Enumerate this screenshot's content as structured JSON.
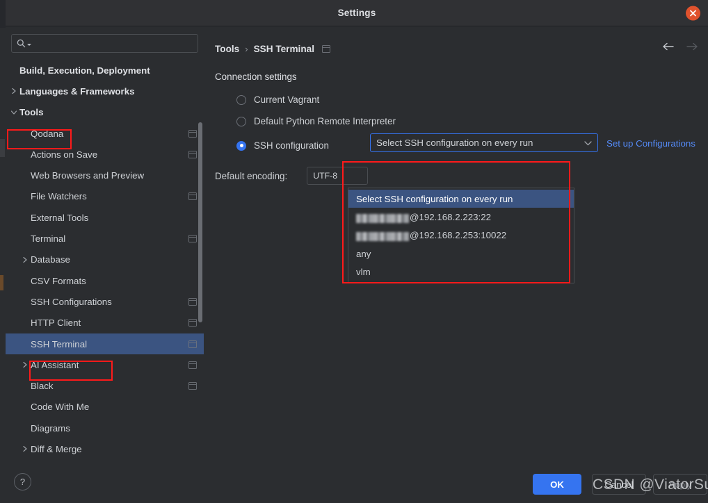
{
  "window": {
    "title": "Settings",
    "close_icon": "close-icon"
  },
  "search": {
    "value": "",
    "placeholder": "",
    "icon": "search-icon"
  },
  "sidebar": {
    "scrollbar": "vertical-scrollbar",
    "items": [
      {
        "label": "Build, Execution, Deployment",
        "level": 0,
        "arrow": "none",
        "badge": false,
        "selected": false,
        "bold": true
      },
      {
        "label": "Languages & Frameworks",
        "level": 0,
        "arrow": "collapsed",
        "badge": false,
        "selected": false,
        "bold": true
      },
      {
        "label": "Tools",
        "level": 0,
        "arrow": "expanded",
        "badge": false,
        "selected": false,
        "bold": true
      },
      {
        "label": "Qodana",
        "level": 1,
        "arrow": "none",
        "badge": true,
        "selected": false,
        "bold": false
      },
      {
        "label": "Actions on Save",
        "level": 1,
        "arrow": "none",
        "badge": true,
        "selected": false,
        "bold": false
      },
      {
        "label": "Web Browsers and Preview",
        "level": 1,
        "arrow": "none",
        "badge": false,
        "selected": false,
        "bold": false
      },
      {
        "label": "File Watchers",
        "level": 1,
        "arrow": "none",
        "badge": true,
        "selected": false,
        "bold": false
      },
      {
        "label": "External Tools",
        "level": 1,
        "arrow": "none",
        "badge": false,
        "selected": false,
        "bold": false
      },
      {
        "label": "Terminal",
        "level": 1,
        "arrow": "none",
        "badge": true,
        "selected": false,
        "bold": false
      },
      {
        "label": "Database",
        "level": 1,
        "arrow": "collapsed",
        "badge": false,
        "selected": false,
        "bold": false
      },
      {
        "label": "CSV Formats",
        "level": 1,
        "arrow": "none",
        "badge": false,
        "selected": false,
        "bold": false
      },
      {
        "label": "SSH Configurations",
        "level": 1,
        "arrow": "none",
        "badge": true,
        "selected": false,
        "bold": false
      },
      {
        "label": "HTTP Client",
        "level": 1,
        "arrow": "none",
        "badge": true,
        "selected": false,
        "bold": false
      },
      {
        "label": "SSH Terminal",
        "level": 1,
        "arrow": "none",
        "badge": true,
        "selected": true,
        "bold": false
      },
      {
        "label": "AI Assistant",
        "level": 1,
        "arrow": "collapsed",
        "badge": true,
        "selected": false,
        "bold": false
      },
      {
        "label": "Black",
        "level": 1,
        "arrow": "none",
        "badge": true,
        "selected": false,
        "bold": false
      },
      {
        "label": "Code With Me",
        "level": 1,
        "arrow": "none",
        "badge": false,
        "selected": false,
        "bold": false
      },
      {
        "label": "Diagrams",
        "level": 1,
        "arrow": "none",
        "badge": false,
        "selected": false,
        "bold": false
      },
      {
        "label": "Diff & Merge",
        "level": 1,
        "arrow": "collapsed",
        "badge": false,
        "selected": false,
        "bold": false
      }
    ]
  },
  "breadcrumb": {
    "root": "Tools",
    "separator": "›",
    "current": "SSH Terminal",
    "badge": "project-settings-badge"
  },
  "navigation": {
    "back_icon": "arrow-left-icon",
    "forward_icon": "arrow-right-icon"
  },
  "main": {
    "section_title": "Connection settings",
    "options": [
      {
        "label": "Current Vagrant",
        "checked": false
      },
      {
        "label": "Default Python Remote Interpreter",
        "checked": false
      },
      {
        "label": "SSH configuration",
        "checked": true
      }
    ],
    "ssh_combo": {
      "value": "Select SSH configuration on every run",
      "caret_icon": "chevron-down-icon"
    },
    "setup_link": "Set up Configurations",
    "encoding": {
      "label": "Default encoding:",
      "value": "UTF-8"
    },
    "dropdown": {
      "items": [
        {
          "text": "Select SSH configuration on every run",
          "selected": true,
          "redacted": false
        },
        {
          "text": "@192.168.2.223:22",
          "selected": false,
          "redacted": true
        },
        {
          "text": "@192.168.2.253:10022",
          "selected": false,
          "redacted": true
        },
        {
          "text": "any",
          "selected": false,
          "redacted": false
        },
        {
          "text": "vlm",
          "selected": false,
          "redacted": false
        }
      ]
    }
  },
  "footer": {
    "help_label": "?",
    "ok_label": "OK",
    "cancel_label": "Cancel",
    "apply_label": "Apply"
  },
  "watermark": {
    "text": "CSDN @ViatorSun"
  },
  "colors": {
    "accent_blue": "#3574f0",
    "selection_blue": "#3b5481",
    "link_blue": "#548af7",
    "annotation_red": "#ff1a1a",
    "close_orange": "#e0522d",
    "window_bg": "#2b2d30"
  }
}
